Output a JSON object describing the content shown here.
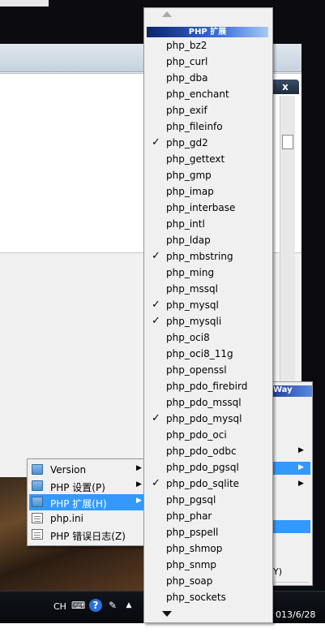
{
  "taskbar": {
    "lang": "CH",
    "date": "013/6/28"
  },
  "window": {
    "close_label": "x"
  },
  "right_menu": {
    "header": "Way",
    "bottom_text": "Y)"
  },
  "context_menu": {
    "items": [
      {
        "label": "Version",
        "icon": "folder-icon",
        "arrow": "▶"
      },
      {
        "label": "PHP 设置(P)",
        "icon": "folder-icon",
        "arrow": "▶"
      },
      {
        "label": "PHP 扩展(H)",
        "icon": "folder-icon",
        "arrow": "▶"
      },
      {
        "label": "php.ini",
        "icon": "file-icon",
        "arrow": ""
      },
      {
        "label": "PHP 错误日志(Z)",
        "icon": "file-icon",
        "arrow": ""
      }
    ]
  },
  "ext_menu": {
    "header": "PHP 扩展",
    "check_glyph": "✓",
    "items": [
      {
        "name": "php_bz2",
        "checked": false
      },
      {
        "name": "php_curl",
        "checked": false
      },
      {
        "name": "php_dba",
        "checked": false
      },
      {
        "name": "php_enchant",
        "checked": false
      },
      {
        "name": "php_exif",
        "checked": false
      },
      {
        "name": "php_fileinfo",
        "checked": false
      },
      {
        "name": "php_gd2",
        "checked": true
      },
      {
        "name": "php_gettext",
        "checked": false
      },
      {
        "name": "php_gmp",
        "checked": false
      },
      {
        "name": "php_imap",
        "checked": false
      },
      {
        "name": "php_interbase",
        "checked": false
      },
      {
        "name": "php_intl",
        "checked": false
      },
      {
        "name": "php_ldap",
        "checked": false
      },
      {
        "name": "php_mbstring",
        "checked": true
      },
      {
        "name": "php_ming",
        "checked": false
      },
      {
        "name": "php_mssql",
        "checked": false
      },
      {
        "name": "php_mysql",
        "checked": true
      },
      {
        "name": "php_mysqli",
        "checked": true
      },
      {
        "name": "php_oci8",
        "checked": false
      },
      {
        "name": "php_oci8_11g",
        "checked": false
      },
      {
        "name": "php_openssl",
        "checked": false
      },
      {
        "name": "php_pdo_firebird",
        "checked": false
      },
      {
        "name": "php_pdo_mssql",
        "checked": false
      },
      {
        "name": "php_pdo_mysql",
        "checked": true
      },
      {
        "name": "php_pdo_oci",
        "checked": false
      },
      {
        "name": "php_pdo_odbc",
        "checked": false
      },
      {
        "name": "php_pdo_pgsql",
        "checked": false
      },
      {
        "name": "php_pdo_sqlite",
        "checked": true
      },
      {
        "name": "php_pgsql",
        "checked": false
      },
      {
        "name": "php_phar",
        "checked": false
      },
      {
        "name": "php_pspell",
        "checked": false
      },
      {
        "name": "php_shmop",
        "checked": false
      },
      {
        "name": "php_snmp",
        "checked": false
      },
      {
        "name": "php_soap",
        "checked": false
      },
      {
        "name": "php_sockets",
        "checked": false
      }
    ]
  },
  "colors": {
    "highlight": "#3399ff",
    "menu_bg": "#f0f0f0"
  }
}
